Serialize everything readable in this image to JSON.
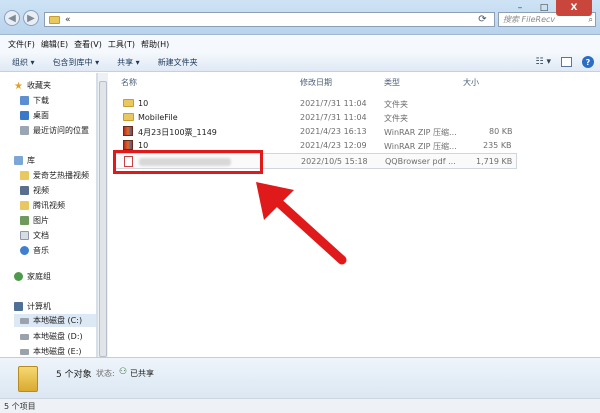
{
  "window": {
    "address_text": "«",
    "search_placeholder": "搜索 FileRecv",
    "controls": {
      "minimize": "–",
      "maximize": "□",
      "close": "X"
    }
  },
  "menu": {
    "items": [
      "文件(F)",
      "编辑(E)",
      "查看(V)",
      "工具(T)",
      "帮助(H)"
    ]
  },
  "toolbar": {
    "organize": "组织 ▾",
    "include": "包含到库中 ▾",
    "share": "共享 ▾",
    "new_folder": "新建文件夹"
  },
  "sidebar": {
    "favorites": "收藏夹",
    "downloads": "下载",
    "desktop": "桌面",
    "recent": "最近访问的位置",
    "library": "库",
    "iqiyi": "爱奇艺热播视频",
    "video": "视频",
    "tencent": "腾讯视频",
    "pictures": "图片",
    "documents": "文档",
    "music": "音乐",
    "homegroup": "家庭组",
    "computer": "计算机",
    "disk_c": "本地磁盘 (C:)",
    "disk_d": "本地磁盘 (D:)",
    "disk_e": "本地磁盘 (E:)"
  },
  "columns": {
    "name": "名称",
    "date": "修改日期",
    "type": "类型",
    "size": "大小"
  },
  "files": [
    {
      "name": "10",
      "date": "2021/7/31 11:04",
      "type": "文件夹",
      "size": ""
    },
    {
      "name": "MobileFile",
      "date": "2021/7/31 11:04",
      "type": "文件夹",
      "size": ""
    },
    {
      "name": "4月23日100票_1149",
      "date": "2021/4/23 16:13",
      "type": "WinRAR ZIP 压缩...",
      "size": "80 KB"
    },
    {
      "name": "10",
      "date": "2021/4/23 12:09",
      "type": "WinRAR ZIP 压缩...",
      "size": "235 KB"
    },
    {
      "name": "",
      "date": "2022/10/5 15:18",
      "type": "QQBrowser pdf ...",
      "size": "1,719 KB"
    }
  ],
  "status": {
    "count": "5 个对象",
    "state_label": "状态:",
    "shared": "已共享",
    "bottom": "5 个项目"
  },
  "colors": {
    "highlight": "#e01a1a",
    "arrow": "#e01a1a"
  }
}
